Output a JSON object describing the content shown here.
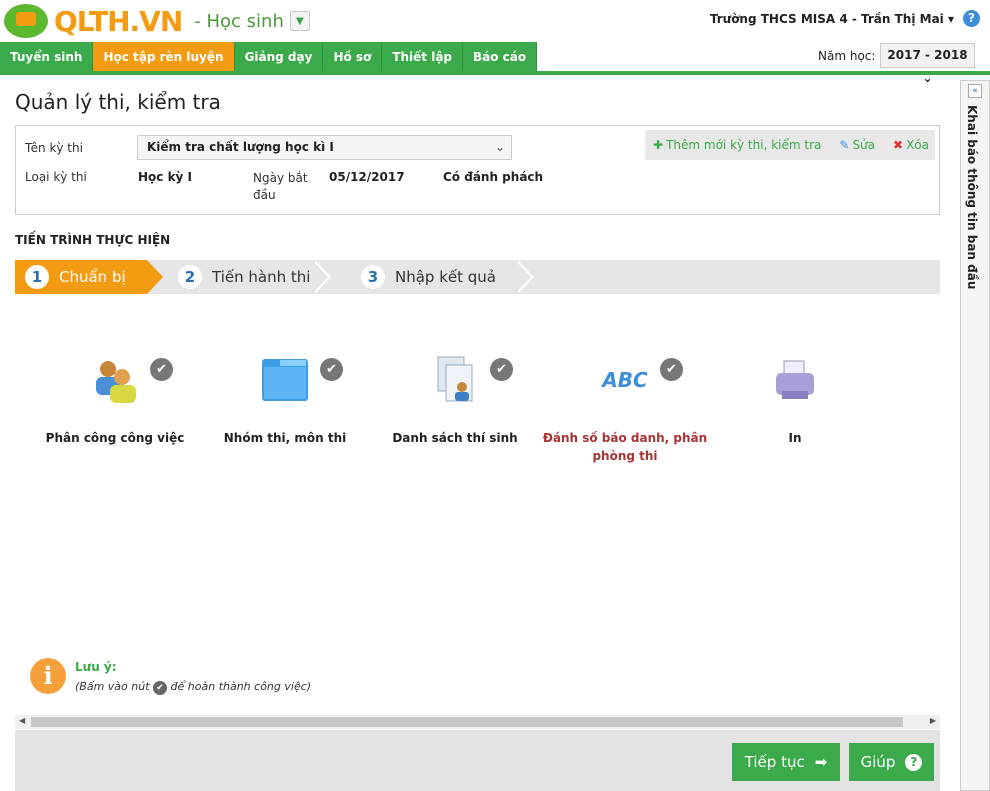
{
  "header": {
    "brand": "QLTH.VN",
    "role": "- Học sinh",
    "user": "Trường THCS MISA 4 - Trần Thị Mai ▾",
    "help": "?"
  },
  "nav": [
    {
      "label": "Tuyển sinh"
    },
    {
      "label": "Học tập rèn luyện"
    },
    {
      "label": "Giảng dạy"
    },
    {
      "label": "Hồ sơ"
    },
    {
      "label": "Thiết lập"
    },
    {
      "label": "Báo cáo"
    }
  ],
  "year": {
    "label": "Năm học:",
    "value": "2017 - 2018"
  },
  "page_title": "Quản lý thi, kiểm tra",
  "info": {
    "exam_label": "Tên kỳ thi",
    "exam_value": "Kiểm tra chất lượng học kì I",
    "type_label": "Loại kỳ thi",
    "type_value": "Học kỳ I",
    "date_label": "Ngày bắt đầu",
    "date_value": "05/12/2017",
    "secret": "Có đánh phách"
  },
  "toolbar": {
    "add": "Thêm mới kỳ thi, kiểm tra",
    "edit": "Sửa",
    "delete": "Xóa"
  },
  "progress": {
    "heading": "TIẾN TRÌNH THỰC HIỆN",
    "steps": [
      {
        "n": "1",
        "label": "Chuẩn bị"
      },
      {
        "n": "2",
        "label": "Tiến hành thi"
      },
      {
        "n": "3",
        "label": "Nhập kết quả"
      }
    ]
  },
  "tasks": [
    {
      "label": "Phân công công việc"
    },
    {
      "label": "Nhóm thi, môn thi"
    },
    {
      "label": "Danh sách thí sinh"
    },
    {
      "label": "Đánh số báo danh, phân phòng thi",
      "abc": "ABC"
    },
    {
      "label": "In"
    }
  ],
  "note": {
    "title": "Lưu ý:",
    "before": "(Bấm vào nút",
    "after": "để hoàn thành công việc)"
  },
  "buttons": {
    "next": "Tiếp tục",
    "help": "Giúp"
  },
  "sidebar": {
    "label": "Khai báo thông tin ban đầu"
  },
  "colors": {
    "green": "#3aaa4a",
    "orange": "#f39c12",
    "red_text": "#a33"
  }
}
